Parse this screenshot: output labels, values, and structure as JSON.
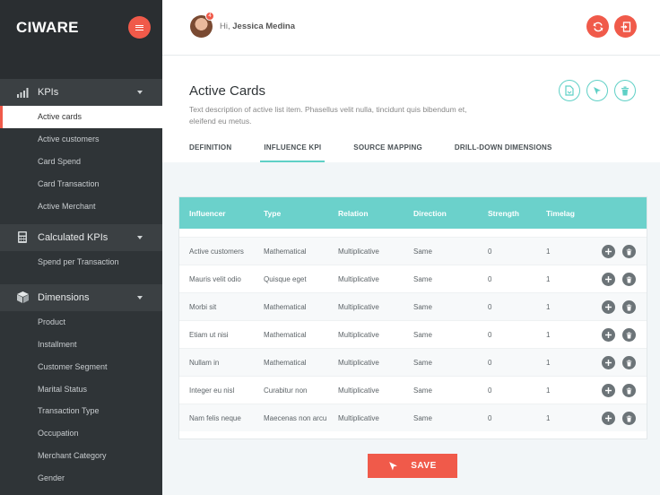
{
  "brand": {
    "logo": "CIWARE"
  },
  "sidebar": {
    "sections": [
      {
        "label": "KPIs",
        "icon": "bar-chart-icon",
        "items": [
          "Active cards",
          "Active customers",
          "Card Spend",
          "Card Transaction",
          "Active Merchant"
        ]
      },
      {
        "label": "Calculated KPIs",
        "icon": "calculator-icon",
        "items": [
          "Spend per Transaction"
        ]
      },
      {
        "label": "Dimensions",
        "icon": "cube-icon",
        "items": [
          "Product",
          "Installment",
          "Customer Segment",
          "Marital Status",
          "Transaction Type",
          "Occupation",
          "Merchant Category",
          "Gender"
        ]
      }
    ],
    "active_item": "Active cards"
  },
  "header": {
    "greeting_prefix": "Hi,",
    "user_name": "Jessica Medina",
    "notification_count": "4"
  },
  "page": {
    "title": "Active Cards",
    "description": "Text description of active list item. Phasellus velit nulla, tincidunt quis bibendum et, eleifend eu metus."
  },
  "tabs": [
    "DEFINITION",
    "INFLUENCE KPI",
    "SOURCE MAPPING",
    "DRILL-DOWN DIMENSIONS"
  ],
  "active_tab": "INFLUENCE KPI",
  "table": {
    "headers": [
      "Influencer",
      "Type",
      "Relation",
      "Direction",
      "Strength",
      "Timelag"
    ],
    "rows": [
      [
        "Active customers",
        "Mathematical",
        "Multiplicative",
        "Same",
        "0",
        "1"
      ],
      [
        "Mauris velit odio",
        "Quisque eget",
        "Multiplicative",
        "Same",
        "0",
        "1"
      ],
      [
        "Morbi sit",
        "Mathematical",
        "Multiplicative",
        "Same",
        "0",
        "1"
      ],
      [
        "Etiam ut nisi",
        "Mathematical",
        "Multiplicative",
        "Same",
        "0",
        "1"
      ],
      [
        "Nullam in",
        "Mathematical",
        "Multiplicative",
        "Same",
        "0",
        "1"
      ],
      [
        " Integer eu nisl",
        "Curabitur non",
        "Multiplicative",
        "Same",
        "0",
        "1"
      ],
      [
        "Nam felis neque",
        "Maecenas non arcu",
        "Multiplicative",
        "Same",
        "0",
        "1"
      ]
    ]
  },
  "actions": {
    "save_label": "SAVE"
  },
  "colors": {
    "accent": "#f05a4a",
    "teal": "#6bd1cb",
    "sidebar": "#2f3437"
  }
}
